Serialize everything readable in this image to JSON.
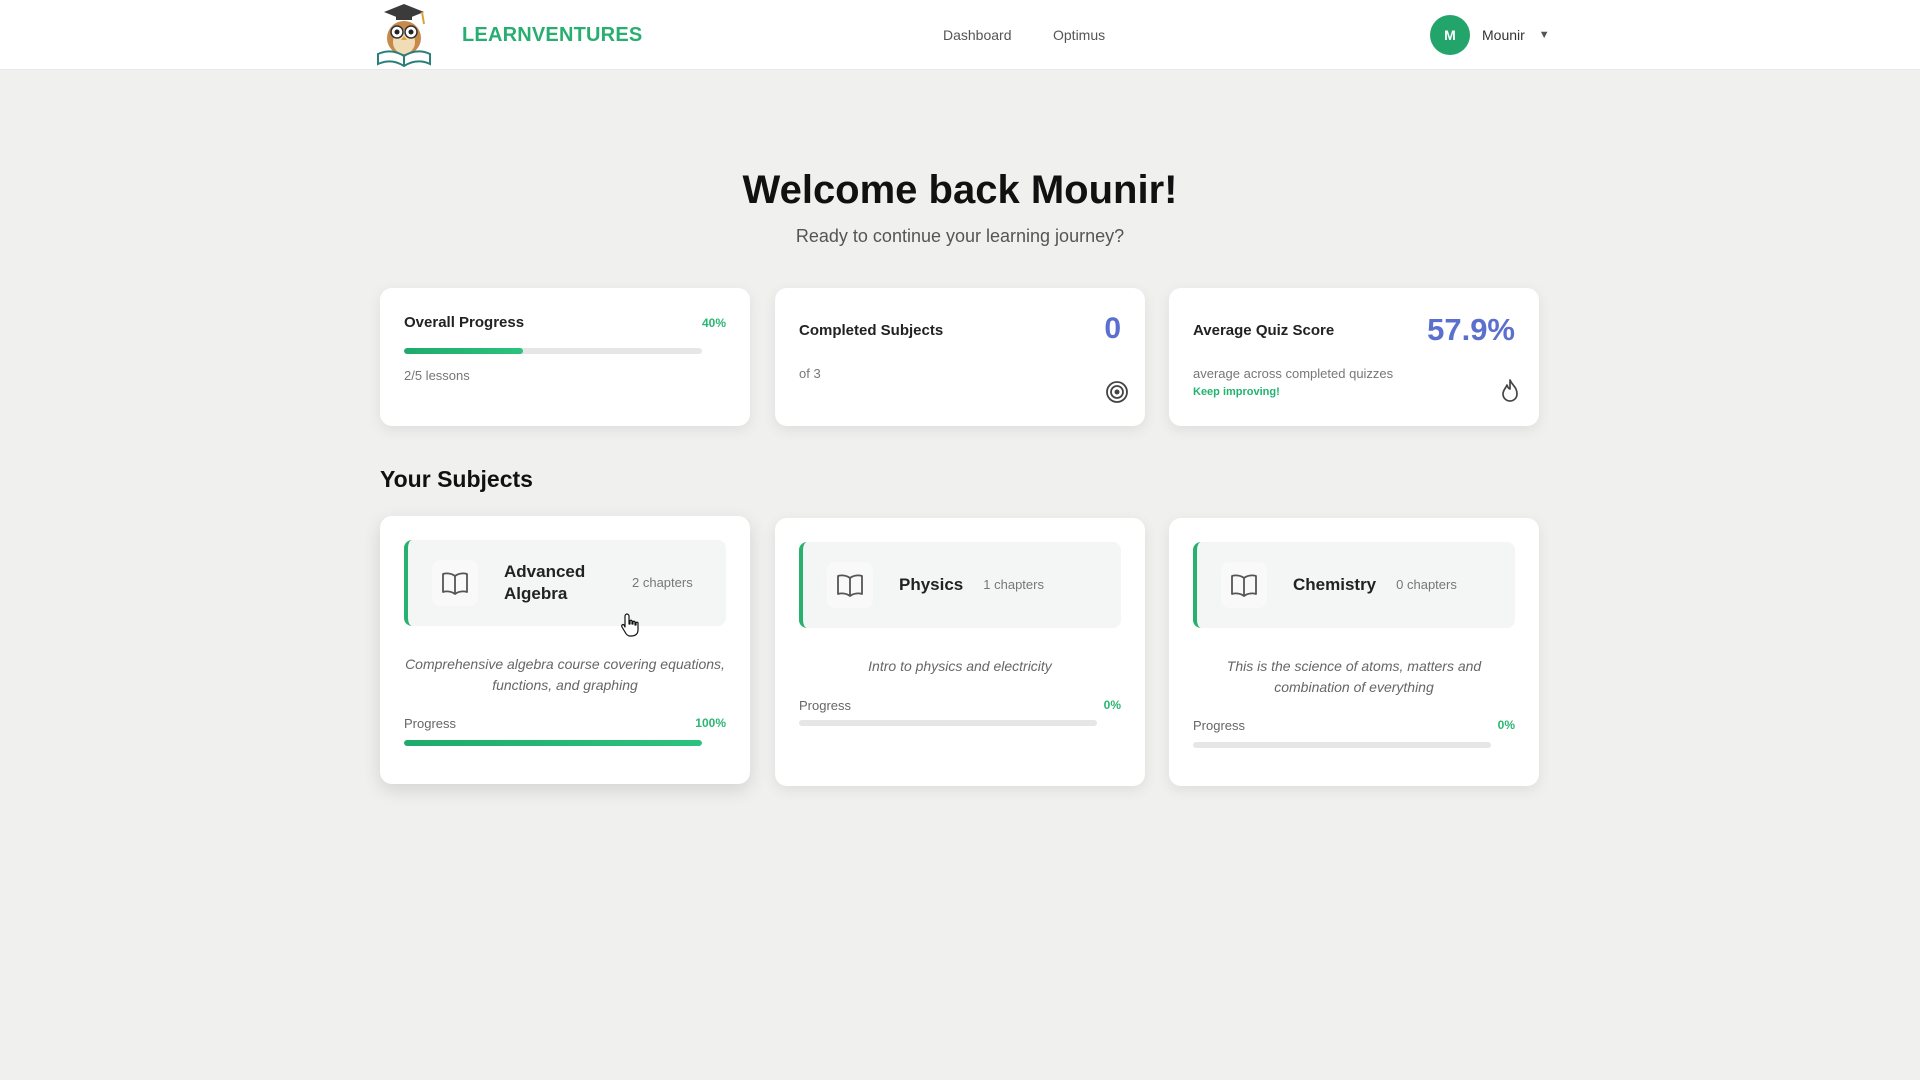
{
  "header": {
    "brand": "LEARNVENTURES",
    "nav": {
      "dashboard": "Dashboard",
      "optimus": "Optimus"
    },
    "user": {
      "initial": "M",
      "name": "Mounir",
      "caret": "▼"
    }
  },
  "hero": {
    "title": "Welcome back Mounir!",
    "subtitle": "Ready to continue your learning journey?"
  },
  "stats": {
    "overall": {
      "label": "Overall Progress",
      "percent_text": "40%",
      "progress": 0.4,
      "detail": "2/5 lessons"
    },
    "completed": {
      "label": "Completed Subjects",
      "value": "0",
      "detail": "of 3",
      "icon": "target-icon"
    },
    "quiz": {
      "label": "Average Quiz Score",
      "value": "57.9%",
      "detail": "average across completed quizzes",
      "hint": "Keep improving!",
      "icon": "flame-icon"
    }
  },
  "subjects_section": {
    "title": "Your Subjects",
    "items": [
      {
        "name": "Advanced Algebra",
        "chapters": "2 chapters",
        "description": "Comprehensive algebra course covering equations, functions, and graphing",
        "progress_label": "Progress",
        "percent_text": "100%",
        "progress": 1.0
      },
      {
        "name": "Physics",
        "chapters": "1 chapters",
        "description": "Intro to physics and electricity",
        "progress_label": "Progress",
        "percent_text": "0%",
        "progress": 0.0
      },
      {
        "name": "Chemistry",
        "chapters": "0 chapters",
        "description": "This is the science of atoms, matters and combination of everything",
        "progress_label": "Progress",
        "percent_text": "0%",
        "progress": 0.0
      }
    ]
  },
  "colors": {
    "accent": "#27ae70",
    "score": "#5b6fcf",
    "avatar": "#22a46a"
  }
}
